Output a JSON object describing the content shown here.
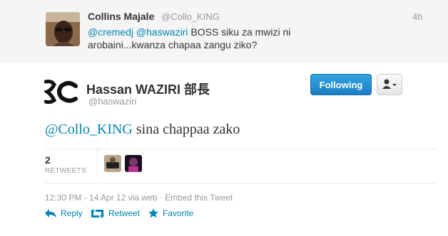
{
  "reply": {
    "name": "Collins Majale",
    "handle": "@Collo_KING",
    "time": "4h",
    "mention1": "@cremedj",
    "mention2": "@haswaziri",
    "text": "BOSS siku za mwizi ni arobaini...kwanza chapaa zangu ziko?"
  },
  "tweet": {
    "name": "Hassan WAZIRI 部長",
    "handle": "@haswaziri",
    "follow_label": "Following",
    "mention": "@Collo_KING",
    "text": " sina chappaa zako",
    "retweet_count": "2",
    "retweet_label": "RETWEETS",
    "meta": "12:30 PM - 14 Apr 12 via web · Embed this Tweet"
  },
  "actions": {
    "reply": "Reply",
    "retweet": "Retweet",
    "favorite": "Favorite"
  },
  "colors": {
    "link": "#0084b4",
    "follow_button": "#2a93d5"
  }
}
